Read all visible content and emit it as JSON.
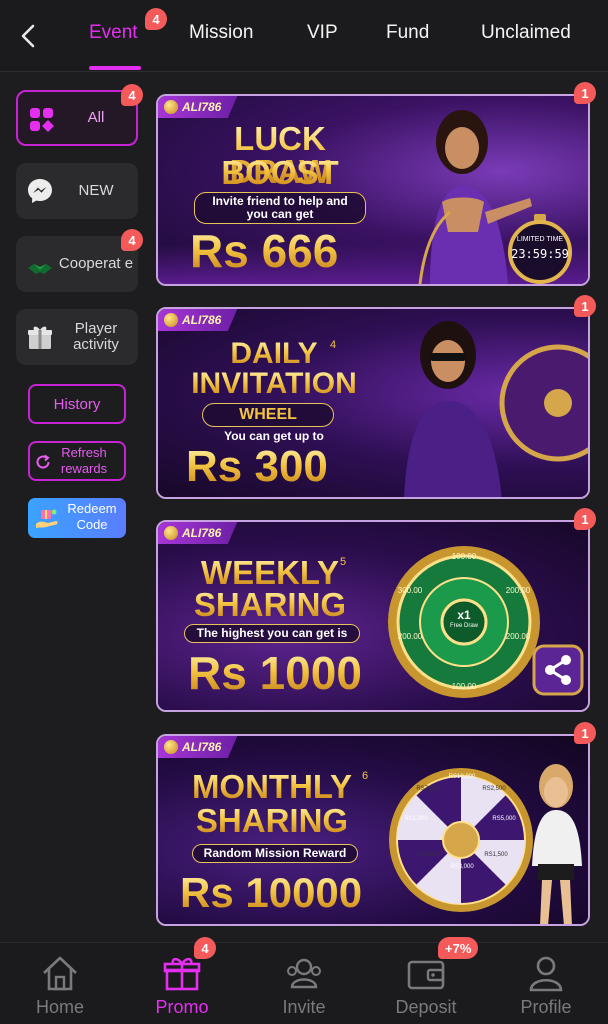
{
  "tabs": [
    {
      "label": "Event",
      "badge": "4"
    },
    {
      "label": "Mission"
    },
    {
      "label": "VIP"
    },
    {
      "label": "Fund"
    },
    {
      "label": "Unclaimed"
    }
  ],
  "sidebar": {
    "items": [
      {
        "label": "All",
        "badge": "4"
      },
      {
        "label": "NEW"
      },
      {
        "label": "Cooperat e",
        "badge": "4"
      },
      {
        "label": "Player activity"
      }
    ],
    "history": "History",
    "refresh": "Refresh rewards",
    "redeem": "Redeem Code"
  },
  "banners": [
    {
      "brand": "ALI786",
      "title1": "LUCK DRAW",
      "title2": "BOOST",
      "subtitle": "Invite friend to help and you can get",
      "amount": "Rs 666",
      "limited": "LIMITED TIME",
      "timer": "23:59:59",
      "badge": "1"
    },
    {
      "brand": "ALI786",
      "title1": "DAILY",
      "title2": "INVITATION",
      "title3": "WHEEL",
      "num": "4",
      "subtitle": "You can get up to",
      "amount": "Rs 300",
      "badge": "1"
    },
    {
      "brand": "ALI786",
      "title1": "WEEKLY",
      "title2": "SHARING",
      "num": "5",
      "subtitle": "The highest you can get is",
      "amount": "Rs 1000",
      "wheel_center": "x1",
      "wheel_sub": "Free Draw",
      "wheel_labels": [
        "100.00",
        "200.00",
        "300.00",
        "200.00",
        "200.00",
        "100.00"
      ],
      "badge": "1"
    },
    {
      "brand": "ALI786",
      "title1": "MONTHLY",
      "title2": "SHARING",
      "num": "6",
      "subtitle": "Random Mission Reward",
      "amount": "Rs 10000",
      "wheel_labels": [
        "RS10,000",
        "RS2,500",
        "RS5,000",
        "RS1,500",
        "RS3,000",
        "RS2,000",
        "RS1,000",
        "RS7,500"
      ],
      "badge": "1"
    }
  ],
  "nav": [
    {
      "label": "Home"
    },
    {
      "label": "Promo",
      "badge": "4"
    },
    {
      "label": "Invite"
    },
    {
      "label": "Deposit",
      "badge": "+7%"
    },
    {
      "label": "Profile"
    }
  ],
  "colors": {
    "accent": "#e42ef0",
    "badge": "#f45a5a",
    "gold": "#f3c442"
  }
}
